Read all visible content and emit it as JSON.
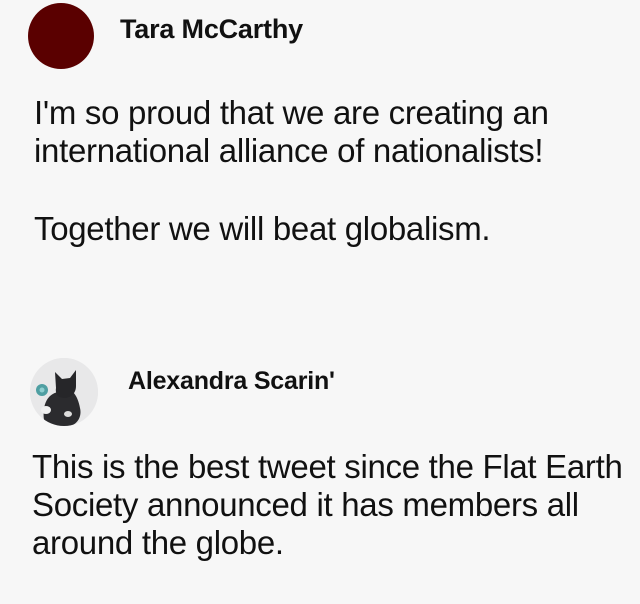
{
  "posts": [
    {
      "author": "Tara McCarthy",
      "avatar_color": "#5a0000",
      "paragraphs": [
        "I'm so proud that we are creating an international alliance of nationalists!",
        "Together we will beat globalism."
      ]
    },
    {
      "author": "Alexandra Scarin'",
      "avatar_icon": "cat-avatar-icon",
      "paragraphs": [
        "This is the best tweet since the Flat Earth Society announced it has members all around the globe."
      ]
    }
  ]
}
